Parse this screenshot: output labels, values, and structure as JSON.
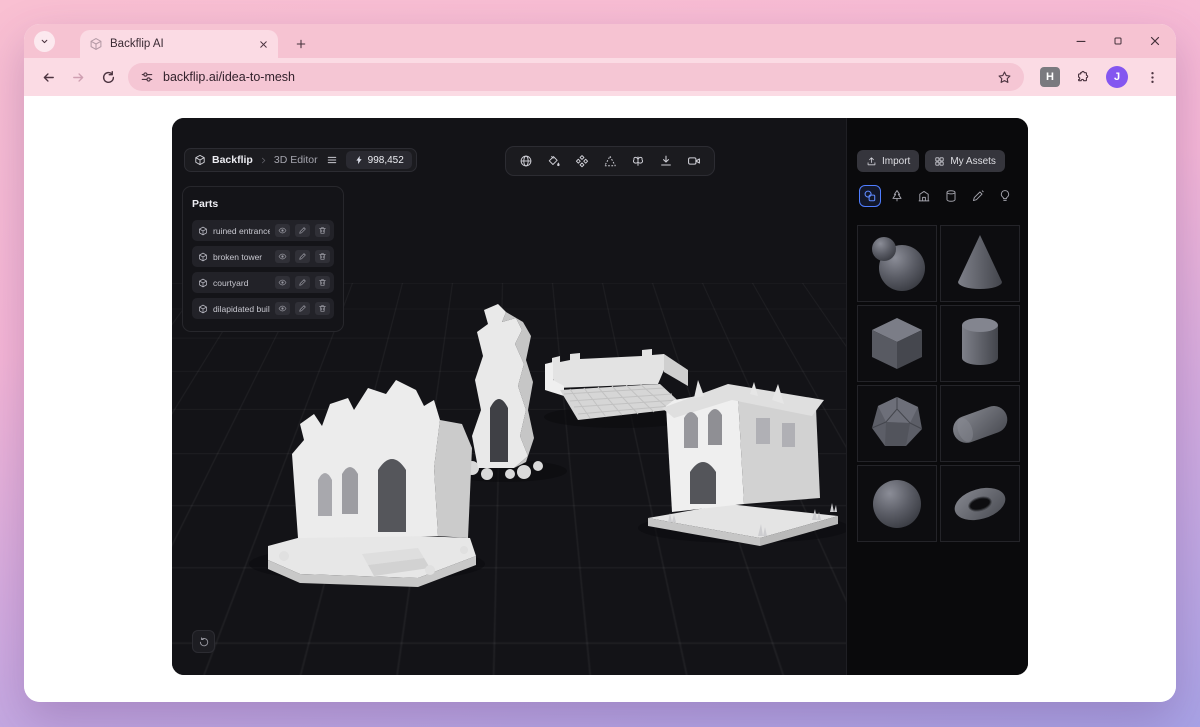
{
  "browser": {
    "tab_title": "Backflip AI",
    "url": "backflip.ai/idea-to-mesh",
    "extension_badge": "H",
    "profile_initial": "J"
  },
  "app": {
    "brand": "Backflip",
    "breadcrumb_page": "3D Editor",
    "credits": "998,452",
    "toolbar_icons": [
      "sphere",
      "material-paint",
      "mesh-diamonds",
      "wireframe-triangle",
      "retopo-butterfly",
      "download",
      "camera"
    ],
    "parts": {
      "title": "Parts",
      "items": [
        "ruined entrance",
        "broken tower",
        "courtyard",
        "dilapidated build..."
      ]
    },
    "library": {
      "import": "Import",
      "my_assets": "My Assets",
      "categories": [
        "shapes",
        "nature",
        "buildings",
        "props",
        "pen",
        "lights"
      ],
      "shapes": [
        "blob-sphere",
        "cone",
        "cube",
        "cylinder",
        "polyhedron",
        "capsule",
        "sphere",
        "torus"
      ]
    },
    "colors": {
      "accent": "#4f7dff",
      "panel_bg": "#141418",
      "app_bg": "#0a0a0c"
    }
  }
}
